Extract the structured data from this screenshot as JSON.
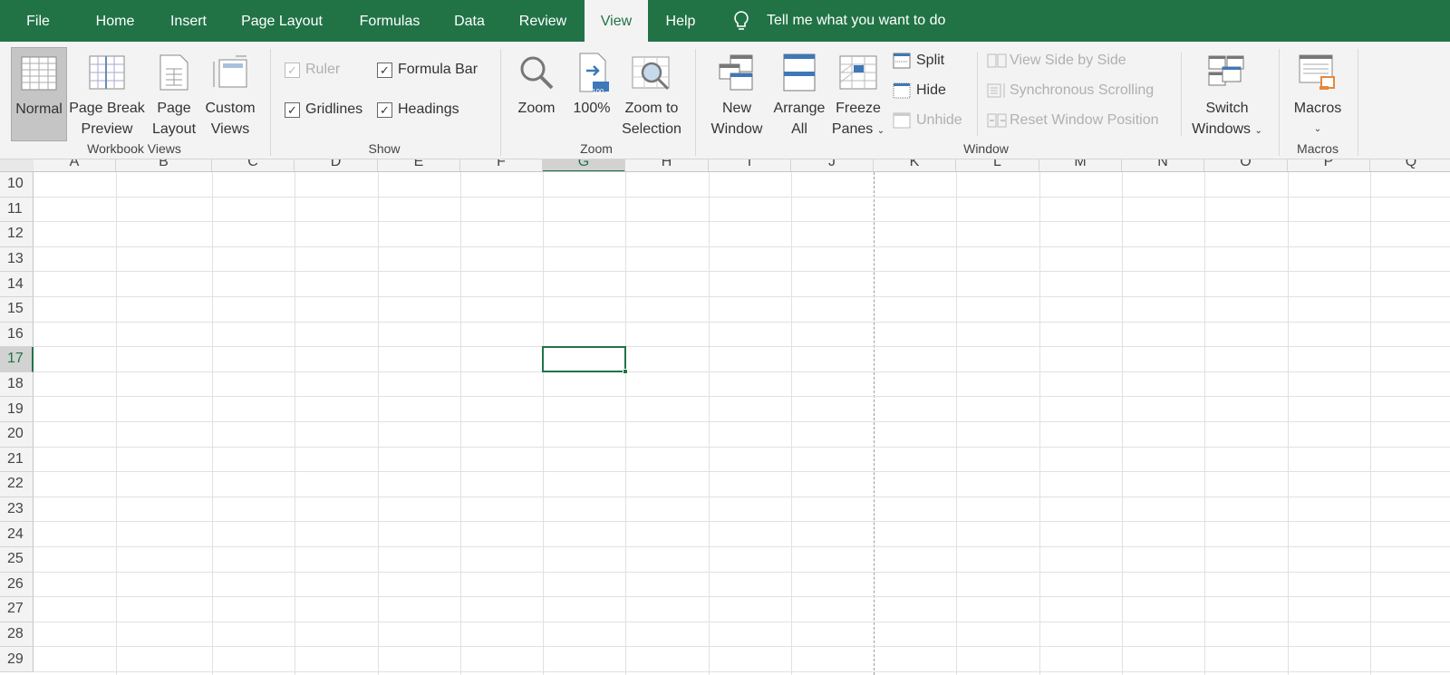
{
  "tabs": [
    {
      "label": "File"
    },
    {
      "label": "Home"
    },
    {
      "label": "Insert"
    },
    {
      "label": "Page Layout"
    },
    {
      "label": "Formulas"
    },
    {
      "label": "Data"
    },
    {
      "label": "Review"
    },
    {
      "label": "View",
      "active": true
    },
    {
      "label": "Help"
    }
  ],
  "tell_me": "Tell me what you want to do",
  "workbook_views": {
    "label": "Workbook Views",
    "normal": "Normal",
    "page_break_1": "Page Break",
    "page_break_2": "Preview",
    "page_layout_1": "Page",
    "page_layout_2": "Layout",
    "custom_1": "Custom",
    "custom_2": "Views"
  },
  "show": {
    "label": "Show",
    "ruler": "Ruler",
    "formula_bar": "Formula Bar",
    "gridlines": "Gridlines",
    "headings": "Headings"
  },
  "zoom": {
    "label": "Zoom",
    "zoom": "Zoom",
    "hundred": "100%",
    "hundred_icon": "100",
    "zts_1": "Zoom to",
    "zts_2": "Selection"
  },
  "window": {
    "label": "Window",
    "new_1": "New",
    "new_2": "Window",
    "arrange_1": "Arrange",
    "arrange_2": "All",
    "freeze_1": "Freeze",
    "freeze_2": "Panes",
    "split": "Split",
    "hide": "Hide",
    "unhide": "Unhide",
    "side_by_side": "View Side by Side",
    "sync": "Synchronous Scrolling",
    "reset": "Reset Window Position",
    "switch_1": "Switch",
    "switch_2": "Windows"
  },
  "macros": {
    "label": "Macros",
    "button": "Macros"
  },
  "columns": [
    "A",
    "B",
    "C",
    "D",
    "E",
    "F",
    "G",
    "H",
    "I",
    "J",
    "K",
    "L",
    "M",
    "N",
    "O",
    "P",
    "Q"
  ],
  "rows": [
    "10",
    "11",
    "12",
    "13",
    "14",
    "15",
    "16",
    "17",
    "18",
    "19",
    "20",
    "21",
    "22",
    "23",
    "24",
    "25",
    "26",
    "27",
    "28",
    "29"
  ],
  "selected_cell": "G17",
  "accent": "#217346"
}
